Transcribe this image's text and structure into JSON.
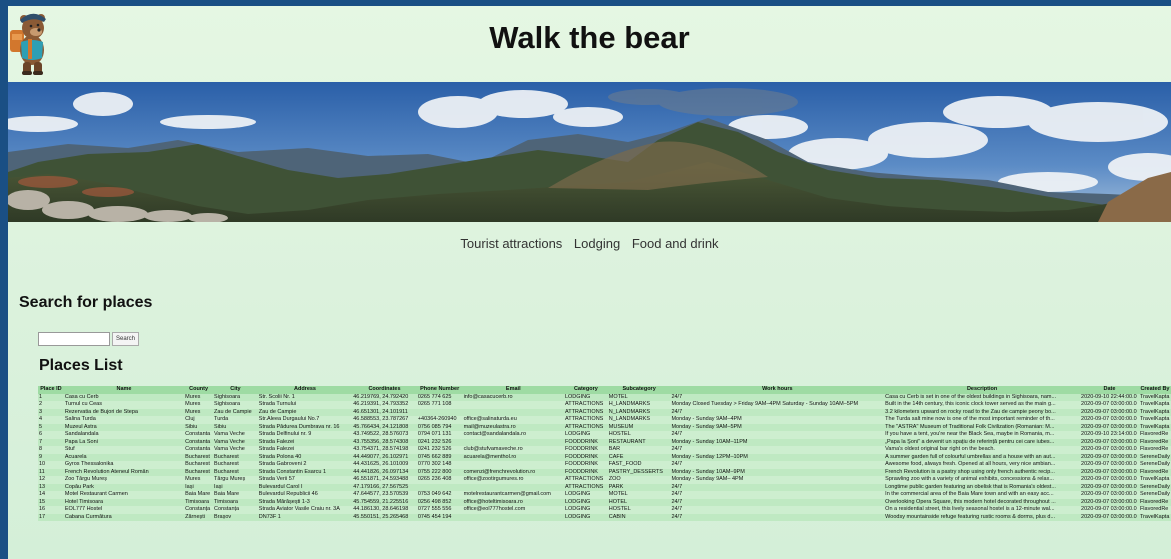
{
  "header": {
    "title": "Walk the bear",
    "logo_icon": "bear-hiker-icon"
  },
  "banner": {
    "image": "mountain-panorama"
  },
  "nav": {
    "items": [
      {
        "label": "Tourist attractions"
      },
      {
        "label": "Lodging"
      },
      {
        "label": "Food and drink"
      }
    ]
  },
  "search": {
    "heading": "Search for places",
    "input_value": "",
    "input_placeholder": "",
    "button_label": "Search"
  },
  "places": {
    "heading": "Places List",
    "columns": [
      "Place ID",
      "Name",
      "County",
      "City",
      "Address",
      "Coordinates",
      "Phone Number",
      "Email",
      "Category",
      "Subcategory",
      "Work hours",
      "Description",
      "Date",
      "Created By"
    ],
    "rows": [
      [
        "1",
        "Casa cu Cerb",
        "Mures",
        "Sighisoara",
        "Str. Scolii Nr. 1",
        "46.219769, 24.792420",
        "0265 774 625",
        "info@casacucerb.ro",
        "LODGING",
        "MOTEL",
        "24/7",
        "Casa cu Cerb is set in one of the oldest buildings in Sighisoara, nam...",
        "2020-09-10 22:44:00.0",
        "TravelKapta"
      ],
      [
        "2",
        "Turnul cu Ceas",
        "Mures",
        "Sighisoara",
        "Strada Turnului",
        "46.219391, 24.793352",
        "0265 771 108",
        "",
        "ATTRACTIONS",
        "H_LANDMARKS",
        "Monday Closed Tuesday > Friday 9AM–4PM Saturday - Sunday 10AM–5PM",
        "Built in the 14th century, this iconic clock tower served as the main g...",
        "2020-09-07 03:00:00.0",
        "TravelKapta"
      ],
      [
        "3",
        "Rezervatia de Bujori de Stepa",
        "Mures",
        "Zau de Campie",
        "Zau de Campie",
        "46.651301, 24.101911",
        "",
        "",
        "ATTRACTIONS",
        "N_LANDMARKS",
        "24/7",
        "3.2 kilometers upward on rocky road to the Zau de campie peony bo...",
        "2020-09-07 03:00:00.0",
        "TravelKapta"
      ],
      [
        "4",
        "Salina Turda",
        "Cluj",
        "Turda",
        "Str.Aleea Durgaului No.7",
        "46.588553, 23.787267",
        "+40364-260940",
        "office@salinaturda.eu",
        "ATTRACTIONS",
        "N_LANDMARKS",
        "Monday - Sunday 9AM–4PM",
        "The Turda salt mine now is one of the most important reminder of th...",
        "2020-09-07 03:00:00.0",
        "TravelKapta"
      ],
      [
        "5",
        "Muzeul Astra",
        "Sibiu",
        "Sibiu",
        "Strada Pădurea Dumbrava nr. 16",
        "45.766434, 24.121808",
        "0756 085 794",
        "mail@muzeulastra.ro",
        "ATTRACTIONS",
        "MUSEUM",
        "Monday - Sunday 9AM–5PM",
        "The \"ASTRA\" Museum of Traditional Folk Civilization (Romanian: M...",
        "2020-09-07 03:00:00.0",
        "TravelKapta"
      ],
      [
        "6",
        "Sandalandala",
        "Constanta",
        "Vama Veche",
        "Strada Delfinului nr. 9",
        "43.749522, 28.576073",
        "0794 071 131",
        "contact@sandalandala.ro",
        "LODGING",
        "HOSTEL",
        "24/7",
        "If you have a tent, you're near the Black Sea, maybe in Romania, m...",
        "2020-09-10 23:14:00.0",
        "FlavoredRe"
      ],
      [
        "7",
        "Papa La Soni",
        "Constanta",
        "Vama Veche",
        "Strada Falezei",
        "43.755356, 28.574308",
        "0241 232 526",
        "",
        "FOODDRINK",
        "RESTAURANT",
        "Monday - Sunday 10AM–11PM",
        "„Papa la Şoni” a devenit un spațiu de referință pentru cei care iubes...",
        "2020-09-07 03:00:00.0",
        "FlavoredRe"
      ],
      [
        "8",
        "Stuf",
        "Constanta",
        "Vama Veche",
        "Strada Falezei",
        "43.754371, 28.574198",
        "0241 232 526",
        "club@stufvamaveche.ro",
        "FOODDRINK",
        "BAR",
        "24/7",
        "Vama's oldest original bar right on the beach.",
        "2020-09-07 03:00:00.0",
        "FlavoredRe"
      ],
      [
        "9",
        "Acuarela",
        "Bucharest",
        "Bucharest",
        "Strada Polona 40",
        "44.449077, 26.102971",
        "0745 662 889",
        "acuarela@menthol.ro",
        "FOODDRINK",
        "CAFE",
        "Monday - Sunday 12PM–10PM",
        "A summer garden full of colourful umbrellas and a house with an aut...",
        "2020-09-07 03:00:00.0",
        "SereneDaily"
      ],
      [
        "10",
        "Gyros Thessalonika",
        "Bucharest",
        "Bucharest",
        "Strada Gabroveni 2",
        "44.431625, 26.101009",
        "0770 302 148",
        "",
        "FOODDRINK",
        "FAST_FOOD",
        "24/7",
        "Awesome food, always fresh. Opened at all hours, very nice ambian...",
        "2020-09-07 03:00:00.0",
        "SereneDaily"
      ],
      [
        "11",
        "French Revolution Ateneul Român",
        "Bucharest",
        "Bucharest",
        "Strada Constantin Esarcu 1",
        "44.441826, 26.097134",
        "0755 222 800",
        "comenzi@frenchrevolution.ro",
        "FOODDRINK",
        "PASTRY_DESSERTS",
        "Monday - Sunday 10AM–9PM",
        "French Revolution is a pastry shop using only french authentic recip...",
        "2020-09-07 03:00:00.0",
        "FlavoredRe"
      ],
      [
        "12",
        "Zoo Târgu Mureș",
        "Mures",
        "Târgu Mureș",
        "Strada Verii 57",
        "46.551871, 24.593488",
        "0265 236 408",
        "office@zootirgumures.ro",
        "ATTRACTIONS",
        "ZOO",
        "Monday - Sunday 9AM– 4PM",
        "Sprawling zoo with a variety of animal exhibits, concessions & relax...",
        "2020-09-07 03:00:00.0",
        "TravelKapta"
      ],
      [
        "13",
        "Copău Park",
        "Iași",
        "Iași",
        "Bulevardul Carol I",
        "47.179166, 27.567525",
        "",
        "",
        "ATTRACTIONS",
        "PARK",
        "24/7",
        "Longtime public garden featuring an obelisk that is Romania's oldest...",
        "2020-09-07 03:00:00.0",
        "SereneDaily"
      ],
      [
        "14",
        "Motel Restaurant Carmen",
        "Baia Mare",
        "Baia Mare",
        "Bulevardul Republicii 46",
        "47.644577, 23.570539",
        "0753 049 642",
        "motelrestaurantcarmen@gmail.com",
        "LODGING",
        "MOTEL",
        "24/7",
        "In the commercial area of the Baia Mare town and with an easy acc...",
        "2020-09-07 03:00:00.0",
        "SereneDaily"
      ],
      [
        "15",
        "Hotel Timisoara",
        "Timisoara",
        "Timisoara",
        "Strada Mărășești 1-3",
        "45.754559, 21.225516",
        "0256 498 852",
        "office@hoteltimisoara.ro",
        "LODGING",
        "HOTEL",
        "24/7",
        "Overlooking Opera Square, this modern hotel decorated throughout ...",
        "2020-09-07 03:00:00.0",
        "FlavoredRe"
      ],
      [
        "16",
        "EOL777 Hostel",
        "Constanța",
        "Constanța",
        "Strada Aviator Vasile Craiu nr. 3A",
        "44.186130, 28.646198",
        "0727 555 556",
        "office@eol777hostel.com",
        "LODGING",
        "HOSTEL",
        "24/7",
        "On a residential street, this lively seasonal hostel is a 12-minute wal...",
        "2020-09-07 03:00:00.0",
        "FlavoredRe"
      ],
      [
        "17",
        "Cabana Curmătura",
        "Zărnești",
        "Brașov",
        "DN73F 1",
        "45.550151, 25.265468",
        "0745 454 194",
        "",
        "LODGING",
        "CABIN",
        "24/7",
        "Woodsy mountainside refuge featuring rustic rooms & dorms, plus d...",
        "2020-09-07 03:00:00.0",
        "TravelKapta"
      ]
    ]
  },
  "colors": {
    "page_background": "#e5f7e3",
    "outer_background": "#1a4f84",
    "table_header": "#9edba3",
    "table_row": "#bfe9c2"
  }
}
